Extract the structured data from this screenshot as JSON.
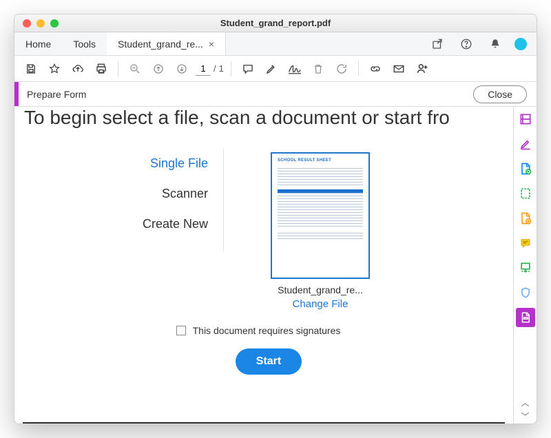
{
  "window": {
    "title": "Student_grand_report.pdf"
  },
  "tabs": {
    "home": "Home",
    "tools": "Tools",
    "doc": "Student_grand_re...",
    "doc_close": "×"
  },
  "toolbar": {
    "page_current": "1",
    "page_sep": "/",
    "page_total": "1"
  },
  "contextbar": {
    "label": "Prepare Form",
    "close": "Close"
  },
  "prepare": {
    "heading": "To begin select a file, scan a document or start fro",
    "options": [
      "Single File",
      "Scanner",
      "Create New"
    ],
    "thumb_title": "SCHOOL RESULT SHEET",
    "thumb_name": "Student_grand_re...",
    "change_file": "Change File",
    "signatures_label": "This document requires signatures",
    "start": "Start"
  },
  "icons": {
    "share_box": "share-box-icon",
    "help": "help-icon",
    "bell": "bell-icon",
    "avatar": "avatar-icon",
    "save": "save-icon",
    "star": "star-icon",
    "cloud_upload": "cloud-upload-icon",
    "print": "print-icon",
    "zoom_out": "zoom-out-icon",
    "arrow_up": "arrow-up-icon",
    "arrow_down": "arrow-down-icon",
    "comment": "comment-icon",
    "highlighter": "highlighter-icon",
    "signature": "signature-icon",
    "trash": "trash-icon",
    "rotate": "rotate-icon",
    "link": "link-icon",
    "mail": "mail-icon",
    "account": "account-icon",
    "rail": [
      "edit-pdf-icon",
      "fill-sign-icon",
      "export-icon",
      "organize-icon",
      "add-page-icon",
      "note-icon",
      "scan-icon",
      "protect-icon",
      "prepare-form-icon"
    ],
    "chev_up": "chevron-up-icon",
    "chev_down": "chevron-down-icon"
  },
  "colors": {
    "brand": "#1f76ce",
    "purple": "#b333c9",
    "green": "#26b14c",
    "orange": "#ff9c1b",
    "gray": "#6c6c6c",
    "blueicon": "#0d8bff"
  }
}
